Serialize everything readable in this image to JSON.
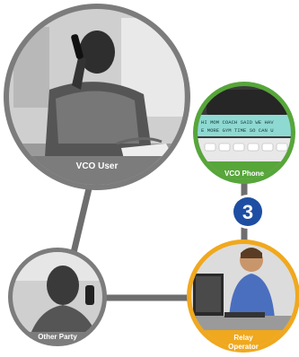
{
  "nodes": {
    "vco_user": {
      "label": "VCO User"
    },
    "vco_phone": {
      "label": "VCO Phone"
    },
    "relay_operator": {
      "label_line1": "Relay",
      "label_line2": "Operator"
    },
    "other_party": {
      "label": "Other Party"
    }
  },
  "phone_screen": {
    "line1": "HI MOM COACH SAID WE HAV",
    "line2": "E MORE GYM TIME SO CAN U"
  },
  "step_badge": {
    "number": "3"
  },
  "colors": {
    "connector": "#6e6e6e",
    "gray_ring": "#7c7c7c",
    "green_ring": "#57a63a",
    "orange_ring": "#f0a81e",
    "badge_blue": "#1d4ea3",
    "phone_screen": "#8fd9d3"
  }
}
